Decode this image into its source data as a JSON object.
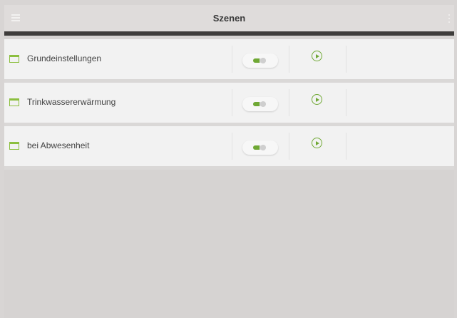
{
  "header": {
    "title": "Szenen",
    "menu_icon": "hamburger-menu-icon",
    "more_icon": "more-vertical-icon"
  },
  "scenes": [
    {
      "label": "Grundeinstellungen",
      "icon": "calendar-icon",
      "toggle_state": "on",
      "action_icon": "play-circle-icon"
    },
    {
      "label": "Trinkwassererwärmung",
      "icon": "calendar-icon",
      "toggle_state": "on",
      "action_icon": "play-circle-icon"
    },
    {
      "label": "bei Abwesenheit",
      "icon": "calendar-icon",
      "toggle_state": "on",
      "action_icon": "play-circle-icon"
    }
  ],
  "colors": {
    "accent_green": "#6fa834",
    "header_border": "#3e3c3b",
    "row_bg": "#f2f2f2",
    "page_bg": "#d6d3d2"
  }
}
